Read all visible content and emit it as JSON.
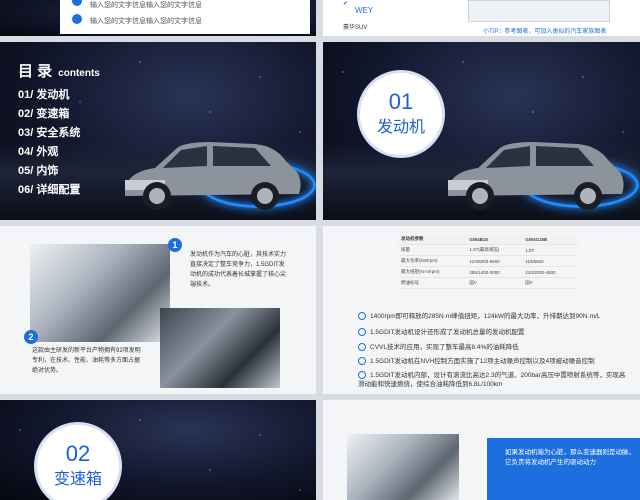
{
  "top_left": {
    "lines": [
      "输入您的文字信息输入您的文字信息",
      "输入您的文字信息输入您的文字信息"
    ]
  },
  "top_right": {
    "brand_checked": "WEY",
    "model": "豪华SUV",
    "tip": "小TIP：参考图表，可加入类似的汽车家族图表"
  },
  "toc_slide": {
    "title": "目 录",
    "subtitle": "contents",
    "items": [
      "01/ 发动机",
      "02/ 变速箱",
      "03/ 安全系统",
      "04/ 外观",
      "05/ 内饰",
      "06/ 详细配置"
    ]
  },
  "section1": {
    "number": "01",
    "name": "发动机"
  },
  "engine_slide": {
    "badge1": "1",
    "text1": "发动机作为汽车的心脏，其技术实力直接决定了整车竞争力，1.5GDIT发动机的成功代表着长城掌握了核心尖端技术。",
    "badge2": "2",
    "text2": "这款由主研发的新平台产物拥有92项发明专利，在技术、性能、油耗等多方面占据绝对优势。"
  },
  "spec_slide": {
    "table_headers": [
      "发动机参数",
      "GW4B15",
      "GW4G15B"
    ],
    "table_rows": [
      [
        "排量",
        "1.5T(最高增压)",
        "1.5T"
      ],
      [
        "最大功率(kW/rpm)",
        "124/5000-5600",
        "110/5600"
      ],
      [
        "最大扭矩(N·m/rpm)",
        "285/1400-3000",
        "210/2000-4500"
      ],
      [
        "燃油标号",
        "国V",
        "国V"
      ]
    ],
    "bullets": [
      "1400rpm即可释放的285N·m峰值扭矩，124kW的最大功率，升排期达到90N·m/L",
      "1.5GDIT发动机设计还形成了发动机总量的发动机配置",
      "CVVL技术的应用，实现了整车最高8.4%的油耗降低",
      "1.5GDIT发动机在NVH控制方面实施了12项主动噪声控制以及4项被动噪音控制",
      "1.5GDIT发动机内部，设计有滚流比高达2.3的气道、200bar高压中置喷射系统等，实现高滑动能和快速燃烧，使综合油耗降低到6.8L/100km"
    ]
  },
  "section2": {
    "number": "02",
    "name": "变速箱"
  },
  "trans_slide": {
    "text": "如果发动机喻为心脏，那么变速器则是动脉，它负责将发动机产生的驱动动力"
  },
  "colors": {
    "accent": "#1d6fe0",
    "red": "#e0312c",
    "dark": "#0b0f1e"
  }
}
